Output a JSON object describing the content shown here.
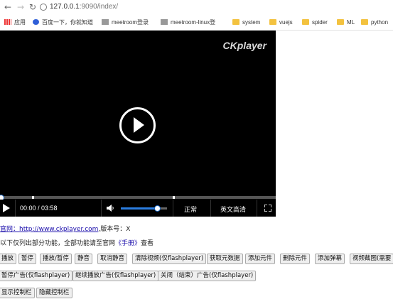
{
  "browser": {
    "url_host": "127.0.0.1",
    "url_port": ":9090",
    "url_path": "/index/",
    "bookmarks": [
      "应用",
      "百度一下，你就知道",
      "meetroom登录",
      "meetroom-linux登",
      "system",
      "vuejs",
      "spider",
      "ML",
      "python"
    ]
  },
  "player": {
    "logo": "CKplayer",
    "time": "00:00 / 03:58",
    "volume_level": 0.78,
    "quality_normal": "正常",
    "quality_hd": "英文高清"
  },
  "info": {
    "site_prefix": "官网：",
    "site_url": "http://www.ckplayer.com",
    "version_text": ",版本号：X",
    "note_prefix": "以下仅列出部分功能，全部功能请至官网",
    "manual_link": "《手册》",
    "note_suffix": "查看"
  },
  "buttons_row1": [
    "播放",
    "暂停",
    "播放/暂停",
    "静音",
    "取消静音",
    "清除视频(仅flashplayer)",
    "获取元数据",
    "添加元件",
    "删除元件",
    "添加弹幕",
    "视频截图(需要"
  ],
  "buttons_row2": [
    "暂停广告(仅flashplayer)",
    "继续播放广告(仅flashplayer)",
    "关闭（结束）广告(仅flashplayer)"
  ],
  "buttons_row3": [
    "显示控制栏",
    "隐藏控制栏"
  ]
}
